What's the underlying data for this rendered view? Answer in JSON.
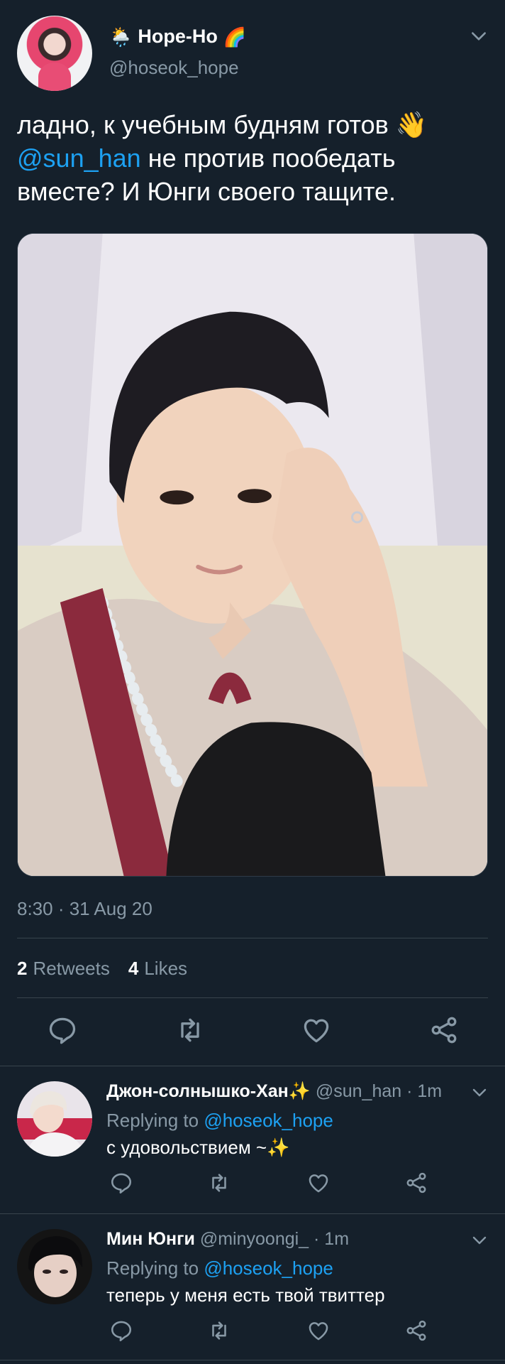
{
  "main_tweet": {
    "emoji_before": "🌦️",
    "display_name": "Hope-Ho",
    "emoji_after": "🌈",
    "handle": "@hoseok_hope",
    "text_part1": "ладно, к учебным будням готов 👋",
    "mention": "@sun_han",
    "text_part2": " не против пообедать вместе? И Юнги своего тащите.",
    "timestamp": "8:30 · 31 Aug 20",
    "retweets_count": "2",
    "retweets_label": "Retweets",
    "likes_count": "4",
    "likes_label": "Likes"
  },
  "replies": [
    {
      "name": "Джон-солнышко-Хан✨",
      "meta": " @sun_han · 1m",
      "replying_label": "Replying to ",
      "replying_to": "@hoseok_hope",
      "text": "с удовольствием ~✨"
    },
    {
      "name": "Мин Юнги",
      "meta": " @minyoongi_ · 1m",
      "replying_label": "Replying to ",
      "replying_to": "@hoseok_hope",
      "text": "теперь у меня есть твой твиттер"
    }
  ],
  "colors": {
    "background": "#15202b",
    "accent": "#1da1f2",
    "secondary_text": "#8899a6",
    "divider": "#38444d"
  },
  "icons": [
    "reply-icon",
    "retweet-icon",
    "like-icon",
    "share-icon",
    "chevron-down-icon"
  ]
}
